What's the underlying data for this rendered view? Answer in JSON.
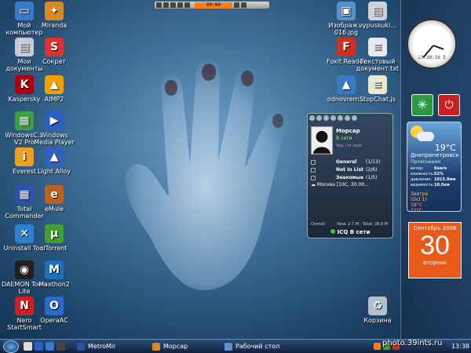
{
  "desktop": {
    "icons": [
      {
        "label": "Мой компьютер",
        "icon": "my-computer-icon",
        "color": "#3a78c8",
        "glyph": "▭"
      },
      {
        "label": "Miranda",
        "icon": "miranda-icon",
        "color": "#d88a20",
        "glyph": "✦"
      },
      {
        "label": "Мои документы",
        "icon": "my-documents-icon",
        "color": "#c8c8d8",
        "glyph": "▤"
      },
      {
        "label": "Сократ",
        "icon": "sokrat-icon",
        "color": "#e03030",
        "glyph": "S"
      },
      {
        "label": "Kaspersky",
        "icon": "kaspersky-icon",
        "color": "#b00010",
        "glyph": "K"
      },
      {
        "label": "AIMP2",
        "icon": "aimp-icon",
        "color": "#f0a000",
        "glyph": "▲"
      },
      {
        "label": "WindowsC... V2 Pro",
        "icon": "windows-commander-icon",
        "color": "#3aa040",
        "glyph": "▦"
      },
      {
        "label": "Windows Media Player",
        "icon": "media-player-icon",
        "color": "#2a60c0",
        "glyph": "▶"
      },
      {
        "label": "Everest",
        "icon": "everest-icon",
        "color": "#f0a020",
        "glyph": "i"
      },
      {
        "label": "Light Alloy",
        "icon": "light-alloy-icon",
        "color": "#3060c0",
        "glyph": "▲"
      },
      {
        "label": "Total Commander",
        "icon": "total-commander-icon",
        "color": "#3050b0",
        "glyph": "▦"
      },
      {
        "label": "eMule",
        "icon": "emule-icon",
        "color": "#c06020",
        "glyph": "e"
      },
      {
        "label": "Uninstall Tool",
        "icon": "uninstall-tool-icon",
        "color": "#3080d0",
        "glyph": "✕"
      },
      {
        "label": "uTorrent",
        "icon": "utorrent-icon",
        "color": "#40a030",
        "glyph": "µ"
      },
      {
        "label": "DAEMON Tools Lite",
        "icon": "daemon-tools-icon",
        "color": "#202020",
        "glyph": "◉"
      },
      {
        "label": "Maxthon2",
        "icon": "maxthon-icon",
        "color": "#2070c0",
        "glyph": "M"
      },
      {
        "label": "Nero StartSmart",
        "icon": "nero-icon",
        "color": "#d02020",
        "glyph": "N"
      },
      {
        "label": "OperaAC",
        "icon": "opera-icon",
        "color": "#2a6ac8",
        "glyph": "O"
      },
      {
        "label": "Изображ... 016.jpg",
        "icon": "image-file-icon",
        "color": "#5a90c8",
        "glyph": "▣"
      },
      {
        "label": "vypuskuki...",
        "icon": "pdf-file-icon",
        "color": "#d0d0d8",
        "glyph": "▤"
      },
      {
        "label": "Foxit Reader",
        "icon": "foxit-reader-icon",
        "color": "#d03020",
        "glyph": "F"
      },
      {
        "label": "Текстовый документ.txt",
        "icon": "text-file-icon",
        "color": "#e8e8f0",
        "glyph": "≡"
      },
      {
        "label": "odnovrem...",
        "icon": "shortcut-icon",
        "color": "#3a78c8",
        "glyph": "▲"
      },
      {
        "label": "StopChat.js",
        "icon": "script-file-icon",
        "color": "#e8e8d0",
        "glyph": "≡"
      },
      {
        "label": "Корзина",
        "icon": "recycle-bin-icon",
        "color": "#b0c0d0",
        "glyph": "♻"
      }
    ]
  },
  "mediabar": {
    "time": "00:00"
  },
  "sidebar": {
    "clock": {
      "time": "13:38:16 E"
    },
    "weather": {
      "temp": "19°C",
      "city": "Днепропетровск",
      "condition": "Прояснения",
      "rows": [
        {
          "k": "ветер:",
          "v": "6км/ч"
        },
        {
          "k": "влажность:",
          "v": "52%"
        },
        {
          "k": "давление:",
          "v": "1013.9мм"
        },
        {
          "k": "видимость:",
          "v": "10.0км"
        }
      ],
      "tomorrow_label": "Завтра",
      "tomorrow_date": "(Oct 1)",
      "tomorrow_hi": "19°C",
      "tomorrow_lo": "11°C"
    },
    "calendar": {
      "month": "Сентябрь 2008",
      "day": "30",
      "weekday": "вторник"
    }
  },
  "icq": {
    "nick": "Морсар",
    "status": "В сети",
    "motto": "Yep, I'm here.",
    "groups": [
      {
        "name": "General",
        "count": "(1/13)"
      },
      {
        "name": "Not In List",
        "count": "(2/6)"
      },
      {
        "name": "Знакомые",
        "count": "(1/5)"
      }
    ],
    "weather_line": "Москва [10C, 30.09...",
    "footer_left": "Overall",
    "footer_right": "Now: 2.7 M - Total: 28.8 M",
    "bottom_status": "ICQ В сети"
  },
  "taskbar": {
    "tasks": [
      {
        "label": "MetroMir",
        "icon": "metromir-icon",
        "color": "#3050a0"
      },
      {
        "label": "Морсар",
        "icon": "miranda-task-icon",
        "color": "#d88a20"
      },
      {
        "label": "Рабочий стол",
        "icon": "desktop-task-icon",
        "color": "#6090c8"
      }
    ],
    "clock": "13:38",
    "watermark": "photo.39ints.ru"
  }
}
